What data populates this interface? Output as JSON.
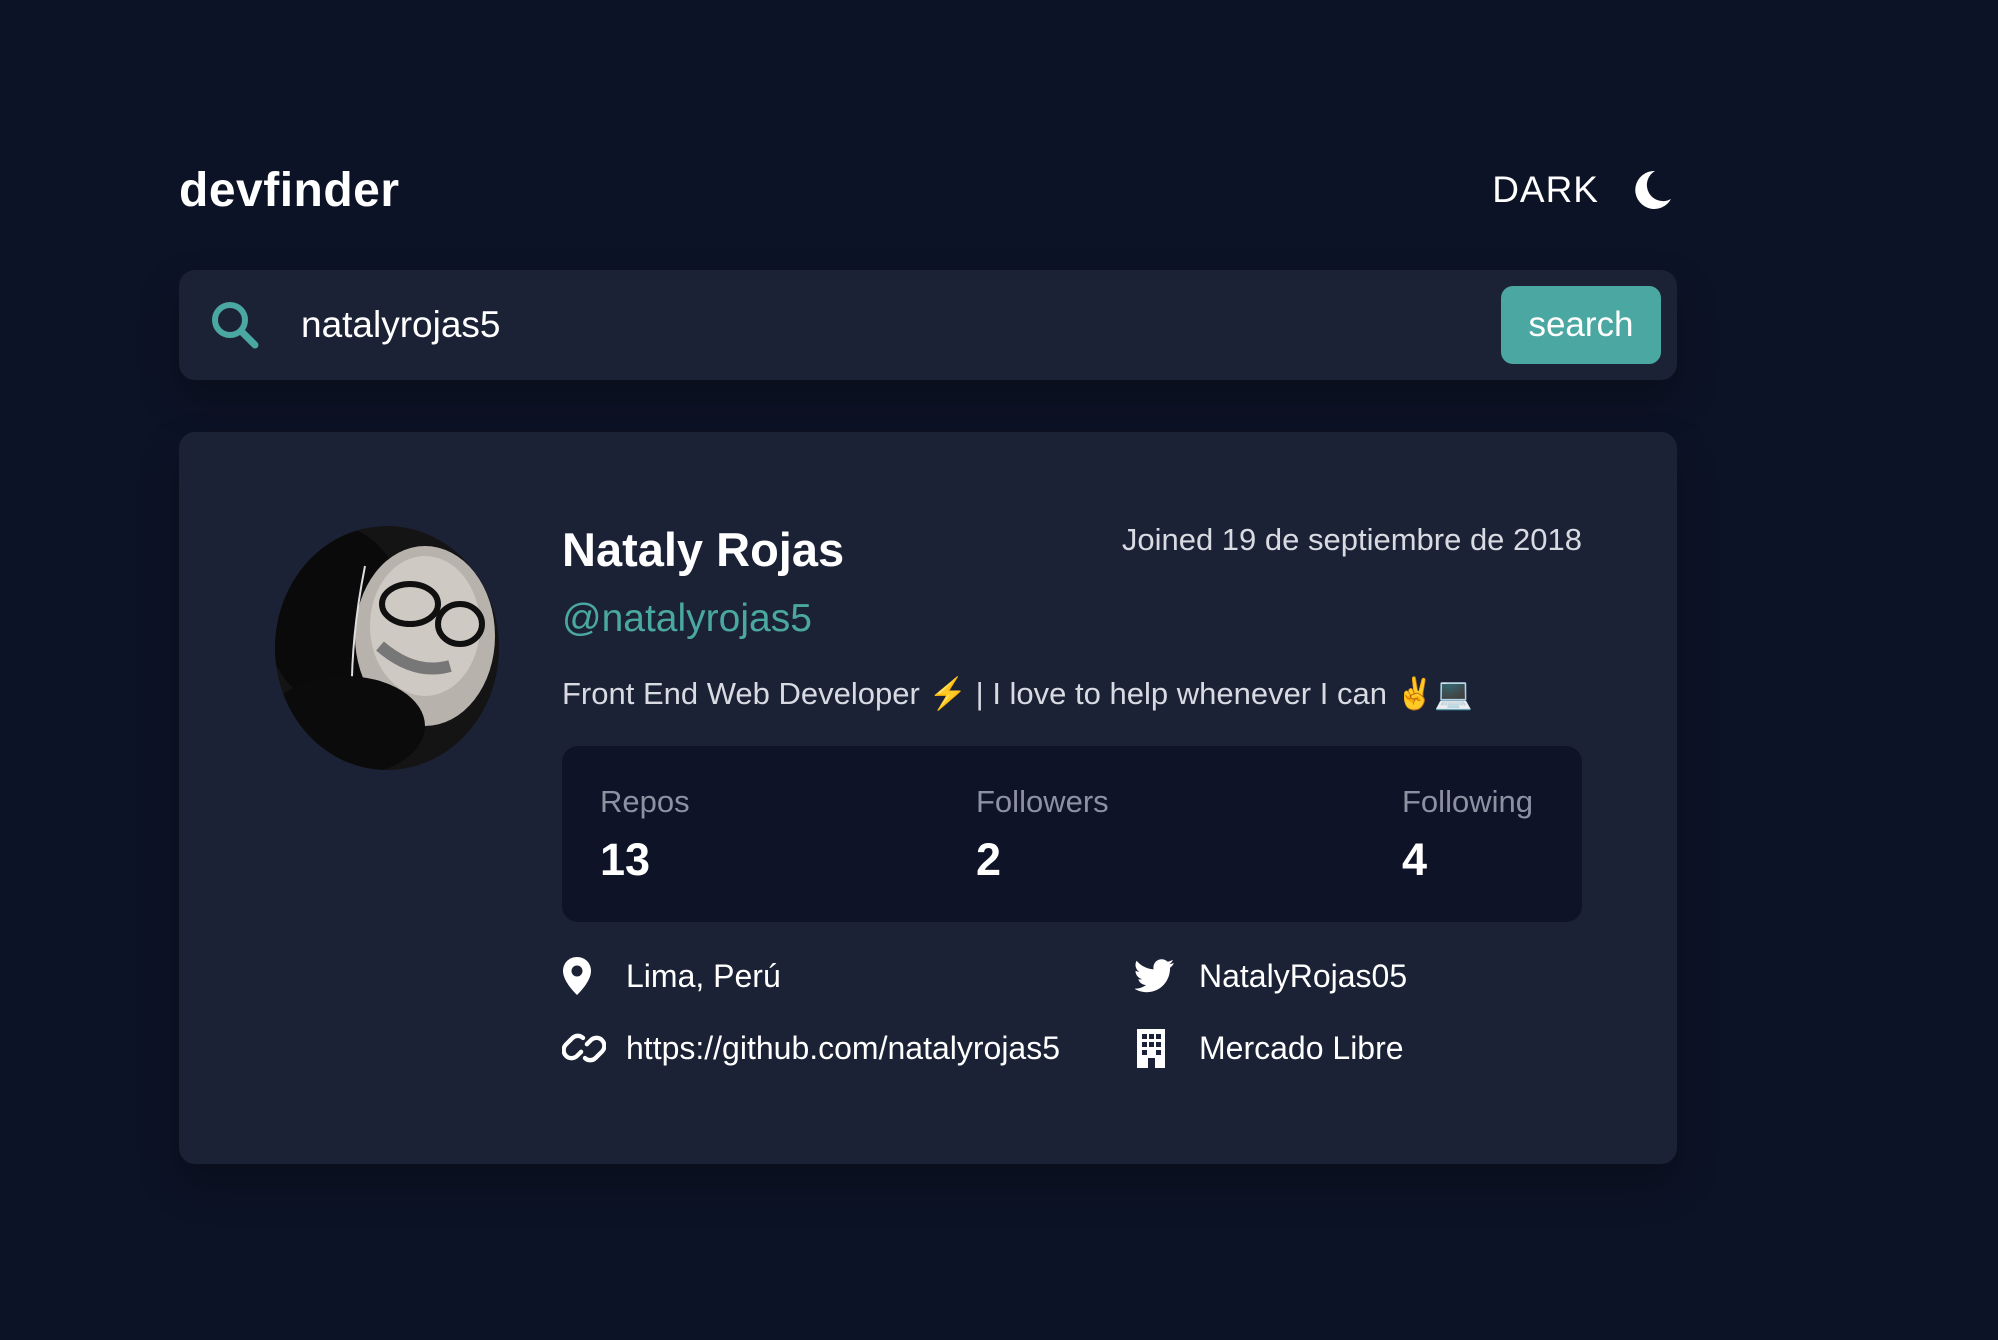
{
  "header": {
    "logo": "devfinder",
    "theme_label": "DARK"
  },
  "search": {
    "value": "natalyrojas5",
    "button_label": "search"
  },
  "profile": {
    "name": "Nataly Rojas",
    "joined": "Joined 19 de septiembre de 2018",
    "handle": "@natalyrojas5",
    "bio": "Front End Web Developer ⚡️ | I love to help whenever I can ✌️💻",
    "stats": {
      "repos_label": "Repos",
      "repos": "13",
      "followers_label": "Followers",
      "followers": "2",
      "following_label": "Following",
      "following": "4"
    },
    "location": "Lima, Perú",
    "twitter": "NatalyRojas05",
    "website": "https://github.com/natalyrojas5",
    "company": "Mercado Libre"
  },
  "colors": {
    "background": "#0d1326",
    "card": "#1c2236",
    "accent": "#4aa7a1",
    "stats_bg": "#0e1327"
  },
  "icons": [
    "moon-icon",
    "search-icon",
    "location-icon",
    "twitter-icon",
    "link-icon",
    "building-icon"
  ]
}
